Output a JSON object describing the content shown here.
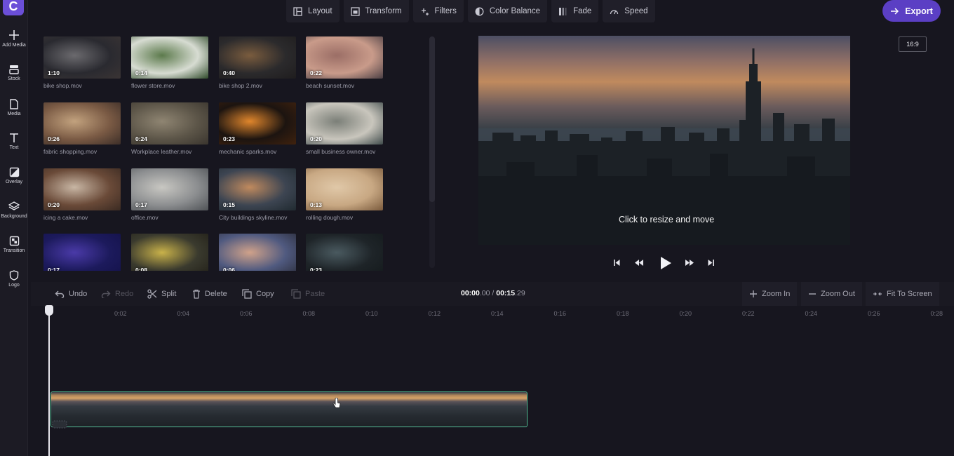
{
  "app": {
    "logo_letter": "C"
  },
  "sidebar": {
    "items": [
      {
        "label": "Add Media",
        "icon": "plus-icon"
      },
      {
        "label": "Stock",
        "icon": "stock-icon"
      },
      {
        "label": "Media",
        "icon": "file-icon"
      },
      {
        "label": "Text",
        "icon": "text-icon"
      },
      {
        "label": "Overlay",
        "icon": "overlay-icon"
      },
      {
        "label": "Background",
        "icon": "layers-icon"
      },
      {
        "label": "Transition",
        "icon": "transition-icon"
      },
      {
        "label": "Logo",
        "icon": "shield-icon"
      }
    ]
  },
  "toolbar": {
    "tabs": [
      {
        "label": "Layout",
        "icon": "layout-icon"
      },
      {
        "label": "Transform",
        "icon": "transform-icon"
      },
      {
        "label": "Filters",
        "icon": "sparkle-icon"
      },
      {
        "label": "Color Balance",
        "icon": "color-balance-icon"
      },
      {
        "label": "Fade",
        "icon": "fade-icon"
      },
      {
        "label": "Speed",
        "icon": "speed-icon"
      }
    ],
    "export_label": "Export"
  },
  "media": {
    "items": [
      {
        "name": "bike shop.mov",
        "duration": "1:10",
        "colors": [
          "#2a2a30",
          "#6b6a6e",
          "#3a3434"
        ]
      },
      {
        "name": "flower store.mov",
        "duration": "0:14",
        "colors": [
          "#d7dcd2",
          "#5c7a4c",
          "#2f4a2a"
        ]
      },
      {
        "name": "bike shop 2.mov",
        "duration": "0:40",
        "colors": [
          "#2b2a2c",
          "#7a5c3e",
          "#1f1d1e"
        ]
      },
      {
        "name": "beach sunset.mov",
        "duration": "0:22",
        "colors": [
          "#c99b8a",
          "#9b6e66",
          "#4b3f44"
        ]
      },
      {
        "name": "fabric shopping.mov",
        "duration": "0:26",
        "colors": [
          "#7a5a44",
          "#c2a27e",
          "#3c2e28"
        ]
      },
      {
        "name": "Workplace leather.mov",
        "duration": "0:24",
        "colors": [
          "#5c5548",
          "#8f8572",
          "#3a352e"
        ]
      },
      {
        "name": "mechanic sparks.mov",
        "duration": "0:23",
        "colors": [
          "#1c1410",
          "#e0862c",
          "#40220e"
        ]
      },
      {
        "name": "small business owner.mov",
        "duration": "0:20",
        "colors": [
          "#c9c6bd",
          "#7b7f78",
          "#3f4a4a"
        ]
      },
      {
        "name": "icing a cake.mov",
        "duration": "0:20",
        "colors": [
          "#6a4a38",
          "#c8b6a4",
          "#3a2a22"
        ]
      },
      {
        "name": "office.mov",
        "duration": "0:17",
        "colors": [
          "#8c8e90",
          "#c8c7c2",
          "#4f5256"
        ]
      },
      {
        "name": "City buildings skyline.mov",
        "duration": "0:15",
        "colors": [
          "#3d4552",
          "#c08a5e",
          "#202a30"
        ]
      },
      {
        "name": "rolling dough.mov",
        "duration": "0:13",
        "colors": [
          "#c8a883",
          "#e0c8a8",
          "#7a5a3c"
        ]
      },
      {
        "name": "",
        "duration": "0:17",
        "colors": [
          "#1c1a5c",
          "#4a3aa8",
          "#14124a"
        ]
      },
      {
        "name": "",
        "duration": "0:08",
        "colors": [
          "#3a3a2e",
          "#c9b24a",
          "#222018"
        ]
      },
      {
        "name": "",
        "duration": "0:06",
        "colors": [
          "#505a80",
          "#d0a28a",
          "#2c2e3c"
        ]
      },
      {
        "name": "",
        "duration": "0:23",
        "colors": [
          "#1e2428",
          "#4a5a60",
          "#141a1c"
        ]
      }
    ]
  },
  "preview": {
    "overlay_text": "Click to resize and move",
    "aspect_ratio": "16:9"
  },
  "transport": {
    "buttons": [
      "skip-back-icon",
      "rewind-icon",
      "play-icon",
      "fast-forward-icon",
      "skip-forward-icon"
    ]
  },
  "edit": {
    "undo": "Undo",
    "redo": "Redo",
    "split": "Split",
    "delete": "Delete",
    "copy": "Copy",
    "paste": "Paste",
    "time_current_main": "00:00",
    "time_current_frac": ".00",
    "time_sep": " / ",
    "time_total_main": "00:15",
    "time_total_frac": ".29",
    "zoom_in": "Zoom In",
    "zoom_out": "Zoom Out",
    "fit": "Fit To Screen"
  },
  "timeline": {
    "ticks": [
      "0:02",
      "0:04",
      "0:06",
      "0:08",
      "0:10",
      "0:12",
      "0:14",
      "0:16",
      "0:18",
      "0:20",
      "0:22",
      "0:24",
      "0:26",
      "0:28"
    ],
    "playhead_seconds": 0,
    "clip_length_seconds": 15.29
  },
  "colors": {
    "accent": "#5b3fc4",
    "clip_border": "#4fb98f",
    "background": "#17161f"
  }
}
